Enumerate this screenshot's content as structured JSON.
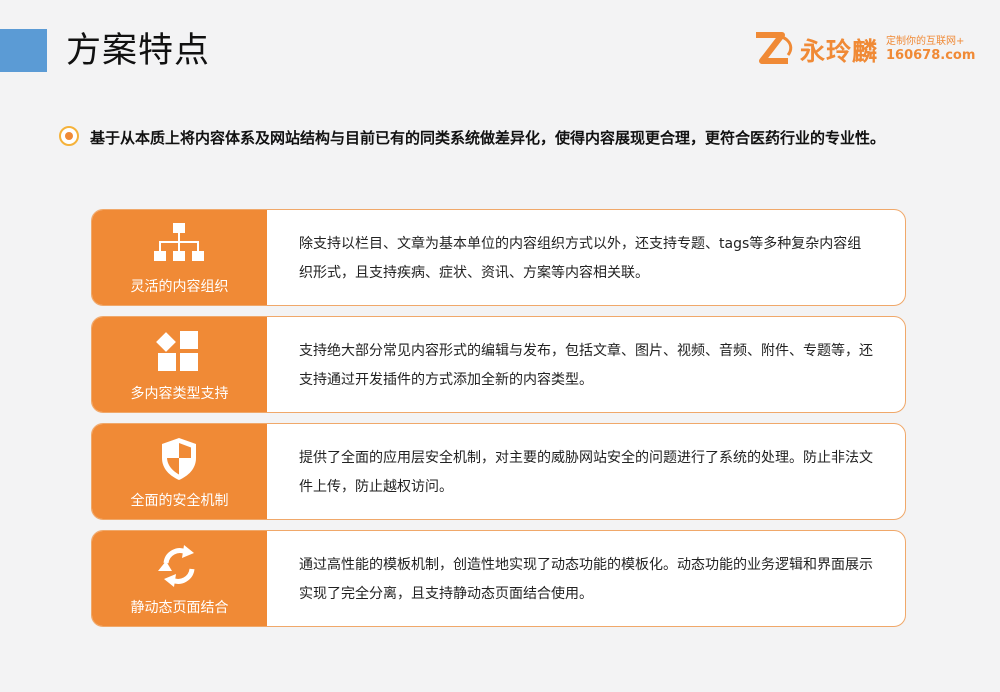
{
  "header": {
    "title": "方案特点"
  },
  "logo": {
    "name": "永玲麟",
    "tagline": "定制你的互联网+",
    "domain": "160678.com",
    "color": "#f08a36"
  },
  "intro": {
    "text": "基于从本质上将内容体系及网站结构与目前已有的同类系统做差异化，使得内容展现更合理，更符合医药行业的专业性。"
  },
  "features": [
    {
      "icon": "org-chart-icon",
      "label": "灵活的内容组织",
      "description": "除支持以栏目、文章为基本单位的内容组织方式以外，还支持专题、tags等多种复杂内容组织形式，且支持疾病、症状、资讯、方案等内容相关联。"
    },
    {
      "icon": "content-types-icon",
      "label": "多内容类型支持",
      "description": "支持绝大部分常见内容形式的编辑与发布，包括文章、图片、视频、音频、附件、专题等，还支持通过开发插件的方式添加全新的内容类型。"
    },
    {
      "icon": "shield-icon",
      "label": "全面的安全机制",
      "description": "提供了全面的应用层安全机制，对主要的威胁网站安全的问题进行了系统的处理。防止非法文件上传，防止越权访问。"
    },
    {
      "icon": "refresh-cycle-icon",
      "label": "静动态页面结合",
      "description": "通过高性能的模板机制，创造性地实现了动态功能的模板化。动态功能的业务逻辑和界面展示实现了完全分离，且支持静动态页面结合使用。"
    }
  ],
  "colors": {
    "accent": "#f08a36",
    "header_bar": "#5b9bd5",
    "background": "#f3f3f4"
  }
}
